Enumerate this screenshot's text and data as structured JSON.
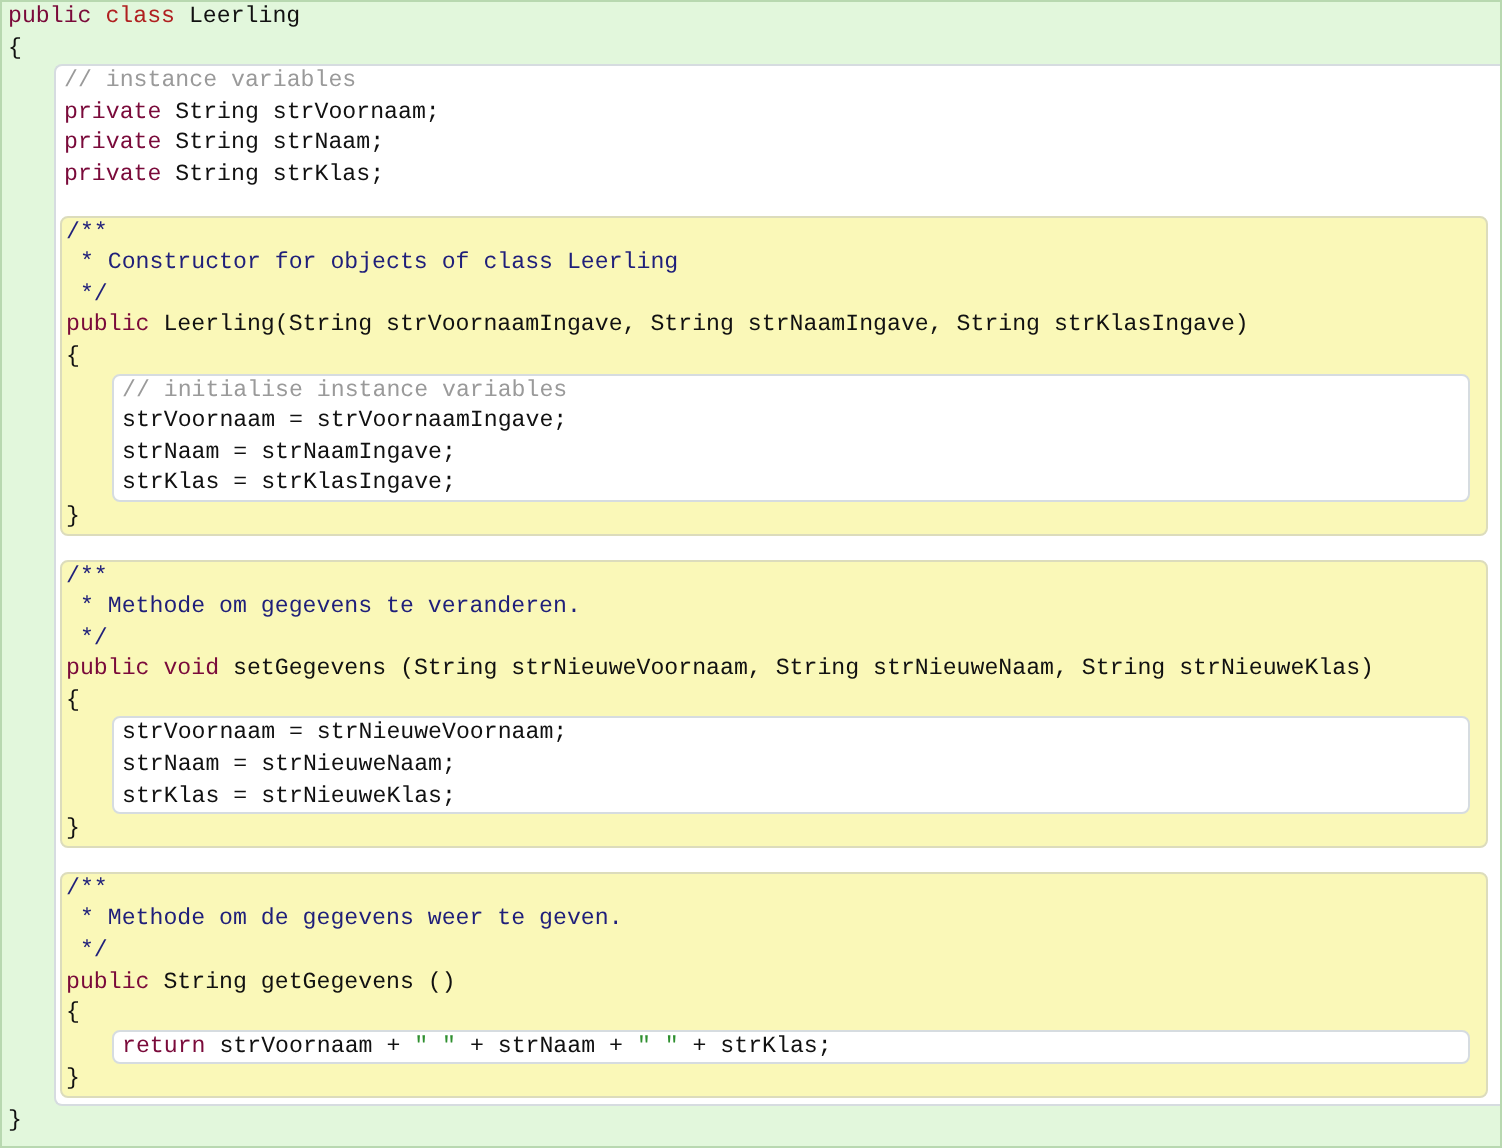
{
  "class": {
    "header": [
      {
        "text": "public ",
        "kind": "keyword"
      },
      {
        "text": "class ",
        "kind": "keyword2"
      },
      {
        "text": "Leerling",
        "kind": "plain"
      }
    ],
    "open": "{",
    "close": "}",
    "fields": [
      [
        {
          "text": "// instance variables",
          "kind": "comment"
        }
      ],
      [
        {
          "text": "private ",
          "kind": "keyword"
        },
        {
          "text": "String strVoornaam;",
          "kind": "plain"
        }
      ],
      [
        {
          "text": "private ",
          "kind": "keyword"
        },
        {
          "text": "String strNaam;",
          "kind": "plain"
        }
      ],
      [
        {
          "text": "private ",
          "kind": "keyword"
        },
        {
          "text": "String strKlas;",
          "kind": "plain"
        }
      ]
    ],
    "methods": [
      {
        "doc": [
          "/**",
          " * Constructor for objects of class Leerling",
          " */"
        ],
        "signature": [
          {
            "text": "public ",
            "kind": "keyword"
          },
          {
            "text": "Leerling(String strVoornaamIngave, String strNaamIngave, String strKlasIngave)",
            "kind": "plain"
          }
        ],
        "open": "{",
        "close": "}",
        "body": [
          [
            {
              "text": "// initialise instance variables",
              "kind": "comment"
            }
          ],
          [
            {
              "text": "strVoornaam = strVoornaamIngave;",
              "kind": "plain"
            }
          ],
          [
            {
              "text": "strNaam = strNaamIngave;",
              "kind": "plain"
            }
          ],
          [
            {
              "text": "strKlas = strKlasIngave;",
              "kind": "plain"
            }
          ]
        ]
      },
      {
        "doc": [
          "/**",
          " * Methode om gegevens te veranderen.",
          " */"
        ],
        "signature": [
          {
            "text": "public ",
            "kind": "keyword"
          },
          {
            "text": "void ",
            "kind": "keyword"
          },
          {
            "text": "setGegevens (String strNieuweVoornaam, String strNieuweNaam, String strNieuweKlas)",
            "kind": "plain"
          }
        ],
        "open": "{",
        "close": "}",
        "body": [
          [
            {
              "text": "strVoornaam = strNieuweVoornaam;",
              "kind": "plain"
            }
          ],
          [
            {
              "text": "strNaam = strNieuweNaam;",
              "kind": "plain"
            }
          ],
          [
            {
              "text": "strKlas = strNieuweKlas;",
              "kind": "plain"
            }
          ]
        ]
      },
      {
        "doc": [
          "/**",
          " * Methode om de gegevens weer te geven.",
          " */"
        ],
        "signature": [
          {
            "text": "public ",
            "kind": "keyword"
          },
          {
            "text": "String getGegevens ()",
            "kind": "plain"
          }
        ],
        "open": "{",
        "close": "}",
        "body": [
          [
            {
              "text": "return ",
              "kind": "keyword"
            },
            {
              "text": "strVoornaam + ",
              "kind": "plain"
            },
            {
              "text": "\" \"",
              "kind": "string"
            },
            {
              "text": " + strNaam + ",
              "kind": "plain"
            },
            {
              "text": "\" \"",
              "kind": "string"
            },
            {
              "text": " + strKlas;",
              "kind": "plain"
            }
          ]
        ]
      }
    ]
  }
}
